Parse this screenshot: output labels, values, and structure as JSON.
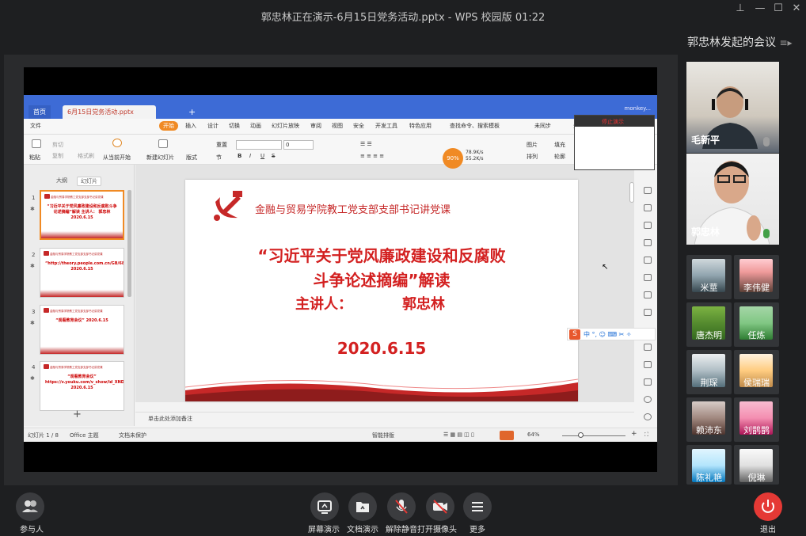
{
  "window": {
    "title": "郭忠林正在演示-6月15日党务活动.pptx - WPS 校园版 01:22"
  },
  "wps": {
    "tab_home": "首页",
    "tab_doc": "6月15日党务活动.pptx",
    "user": "monkey...",
    "menu": [
      "文件",
      "开始",
      "插入",
      "设计",
      "切换",
      "动画",
      "幻灯片放映",
      "审阅",
      "视图",
      "安全",
      "开发工具",
      "特色应用",
      "查找命令、搜索模板",
      "未同步",
      "分"
    ],
    "toolbar": {
      "paste": "粘贴",
      "cut": "剪切",
      "copy": "复制",
      "format_painter": "格式刷",
      "from_current": "从当前开始",
      "new_slide": "新建幻灯片",
      "layout": "版式",
      "section": "节",
      "reset": "重置",
      "font_size": "0",
      "picture": "图片",
      "fill": "填充",
      "arrange": "排列",
      "shape_fx": "轮廓"
    },
    "perf": {
      "percent": "90%",
      "up": "78.9K/s",
      "down": "55.2K/s"
    },
    "panel_tabs": [
      "大纲",
      "幻灯片"
    ],
    "thumbs": [
      {
        "num": "1",
        "head": "金融与贸易学院教工党支部支部书记讲党课",
        "body": "“习近平关于党风廉政建设和反腐败斗争论述摘编”解读 主讲人： 郭忠林 2020.6.15"
      },
      {
        "num": "2",
        "head": "金融与贸易学院教工党支部支部书记讲党课",
        "body": "“http://theory.people.com.cn/GB/68294/392503/” 2020.6.15"
      },
      {
        "num": "3",
        "head": "金融与贸易学院教工党支部支部书记讲党课",
        "body": "“观看教育会议” 2020.6.15"
      },
      {
        "num": "4",
        "head": "金融与贸易学院教工党支部支部书记讲党课",
        "body": "“观看教育会议” https://v.youku.com/v_show/id_XNDY4MDk3ODg2OA==.html 2020.6.15"
      }
    ],
    "slide": {
      "header": "金融与贸易学院教工党支部支部书记讲党课",
      "title_line1": "“习近平关于党风廉政建设和反腐败",
      "title_line2": "斗争论述摘编”解读",
      "speaker_label": "主讲人：",
      "speaker_name": "郭忠林",
      "date": "2020.6.15"
    },
    "notes_placeholder": "单击此处添加备注",
    "status": {
      "slide_count": "幻灯片 1 / 8",
      "theme": "Office 主题",
      "protect": "文档未保护",
      "smart": "智能排版",
      "zoom": "64%"
    },
    "presenter_stop": "停止演示",
    "ime": "中 °, ☺ ⌨ ✂ ✧"
  },
  "meeting": {
    "sidebar_title": "郭忠林发起的会议",
    "large_tiles": [
      {
        "name": "毛新平"
      },
      {
        "name": "郭忠林"
      }
    ],
    "small_tiles": [
      {
        "name": "米莖"
      },
      {
        "name": "李伟健"
      },
      {
        "name": "唐杰明"
      },
      {
        "name": "任炼"
      },
      {
        "name": "荆琛"
      },
      {
        "name": "侯瑞瑞"
      },
      {
        "name": "赖沛东"
      },
      {
        "name": "刘鹊鹊"
      },
      {
        "name": "陈礼艳"
      },
      {
        "name": "倪琳"
      }
    ],
    "controls": [
      {
        "label": "参与人",
        "icon": "participants-icon"
      },
      {
        "label": "屏幕演示",
        "icon": "screen-share-icon"
      },
      {
        "label": "文档演示",
        "icon": "doc-share-icon"
      },
      {
        "label": "解除静音",
        "icon": "mic-muted-icon"
      },
      {
        "label": "打开摄像头",
        "icon": "camera-off-icon"
      },
      {
        "label": "更多",
        "icon": "more-icon"
      }
    ],
    "exit_label": "退出"
  }
}
